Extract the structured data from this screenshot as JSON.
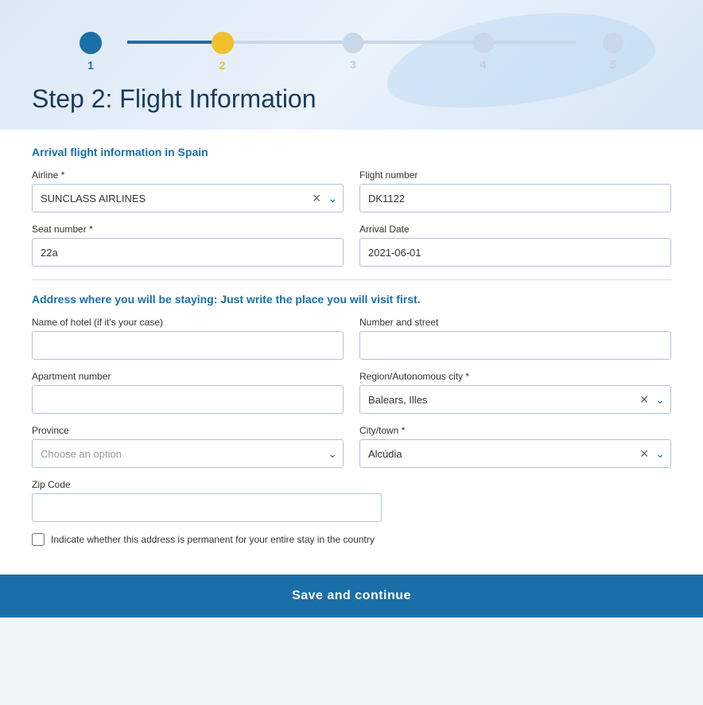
{
  "header": {
    "title": "Step 2: Flight Information"
  },
  "progress": {
    "steps": [
      {
        "number": "1",
        "state": "completed"
      },
      {
        "number": "2",
        "state": "active"
      },
      {
        "number": "3",
        "state": "inactive"
      },
      {
        "number": "4",
        "state": "inactive"
      },
      {
        "number": "5",
        "state": "inactive"
      }
    ]
  },
  "arrival_section": {
    "title": "Arrival flight information in Spain",
    "airline_label": "Airline *",
    "airline_value": "SUNCLASS AIRLINES",
    "flight_number_label": "Flight number",
    "flight_number_value": "DK1122",
    "seat_number_label": "Seat number *",
    "seat_number_value": "22a",
    "arrival_date_label": "Arrival Date",
    "arrival_date_value": "2021-06-01"
  },
  "address_section": {
    "title": "Address where you will be staying: Just write the place you will visit first.",
    "hotel_label": "Name of hotel (if it's your case)",
    "hotel_value": "",
    "street_label": "Number and street",
    "street_value": "",
    "apartment_label": "Apartment number",
    "apartment_value": "",
    "region_label": "Region/Autonomous city *",
    "region_value": "Balears, Illes",
    "province_label": "Province",
    "province_value": "Choose an option",
    "city_label": "City/town *",
    "city_value": "Alcúdia",
    "zip_label": "Zip Code",
    "zip_value": "",
    "checkbox_label": "Indicate whether this address is permanent for your entire stay in the country"
  },
  "buttons": {
    "save_label": "Save and continue"
  }
}
